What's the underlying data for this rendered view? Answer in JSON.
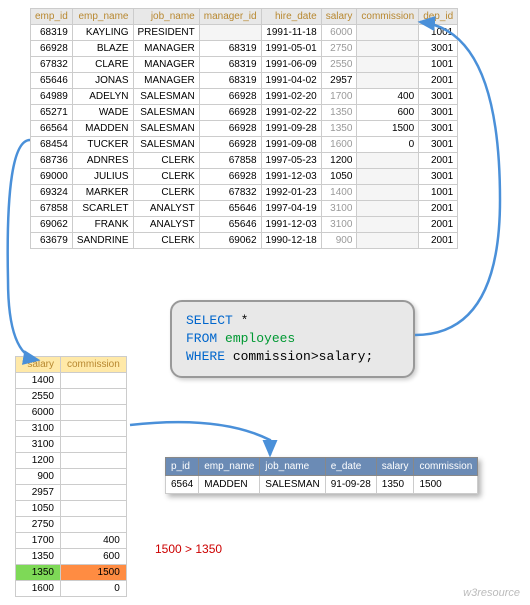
{
  "main_table": {
    "headers": [
      "emp_id",
      "emp_name",
      "job_name",
      "manager_id",
      "hire_date",
      "salary",
      "commission",
      "dep_id"
    ],
    "rows": [
      {
        "emp_id": "68319",
        "emp_name": "KAYLING",
        "job_name": "PRESIDENT",
        "manager_id": "",
        "hire_date": "1991-11-18",
        "salary": "6000",
        "commission": "",
        "dep_id": "1001"
      },
      {
        "emp_id": "66928",
        "emp_name": "BLAZE",
        "job_name": "MANAGER",
        "manager_id": "68319",
        "hire_date": "1991-05-01",
        "salary": "2750",
        "commission": "",
        "dep_id": "3001"
      },
      {
        "emp_id": "67832",
        "emp_name": "CLARE",
        "job_name": "MANAGER",
        "manager_id": "68319",
        "hire_date": "1991-06-09",
        "salary": "2550",
        "commission": "",
        "dep_id": "1001"
      },
      {
        "emp_id": "65646",
        "emp_name": "JONAS",
        "job_name": "MANAGER",
        "manager_id": "68319",
        "hire_date": "1991-04-02",
        "salary": "2957",
        "commission": "",
        "dep_id": "2001"
      },
      {
        "emp_id": "64989",
        "emp_name": "ADELYN",
        "job_name": "SALESMAN",
        "manager_id": "66928",
        "hire_date": "1991-02-20",
        "salary": "1700",
        "commission": "400",
        "dep_id": "3001"
      },
      {
        "emp_id": "65271",
        "emp_name": "WADE",
        "job_name": "SALESMAN",
        "manager_id": "66928",
        "hire_date": "1991-02-22",
        "salary": "1350",
        "commission": "600",
        "dep_id": "3001"
      },
      {
        "emp_id": "66564",
        "emp_name": "MADDEN",
        "job_name": "SALESMAN",
        "manager_id": "66928",
        "hire_date": "1991-09-28",
        "salary": "1350",
        "commission": "1500",
        "dep_id": "3001"
      },
      {
        "emp_id": "68454",
        "emp_name": "TUCKER",
        "job_name": "SALESMAN",
        "manager_id": "66928",
        "hire_date": "1991-09-08",
        "salary": "1600",
        "commission": "0",
        "dep_id": "3001"
      },
      {
        "emp_id": "68736",
        "emp_name": "ADNRES",
        "job_name": "CLERK",
        "manager_id": "67858",
        "hire_date": "1997-05-23",
        "salary": "1200",
        "commission": "",
        "dep_id": "2001"
      },
      {
        "emp_id": "69000",
        "emp_name": "JULIUS",
        "job_name": "CLERK",
        "manager_id": "66928",
        "hire_date": "1991-12-03",
        "salary": "1050",
        "commission": "",
        "dep_id": "3001"
      },
      {
        "emp_id": "69324",
        "emp_name": "MARKER",
        "job_name": "CLERK",
        "manager_id": "67832",
        "hire_date": "1992-01-23",
        "salary": "1400",
        "commission": "",
        "dep_id": "1001"
      },
      {
        "emp_id": "67858",
        "emp_name": "SCARLET",
        "job_name": "ANALYST",
        "manager_id": "65646",
        "hire_date": "1997-04-19",
        "salary": "3100",
        "commission": "",
        "dep_id": "2001"
      },
      {
        "emp_id": "69062",
        "emp_name": "FRANK",
        "job_name": "ANALYST",
        "manager_id": "65646",
        "hire_date": "1991-12-03",
        "salary": "3100",
        "commission": "",
        "dep_id": "2001"
      },
      {
        "emp_id": "63679",
        "emp_name": "SANDRINE",
        "job_name": "CLERK",
        "manager_id": "69062",
        "hire_date": "1990-12-18",
        "salary": "900",
        "commission": "",
        "dep_id": "2001"
      }
    ]
  },
  "sql": {
    "l1a": "SELECT ",
    "l1b": "*",
    "l2a": "FROM ",
    "l2b": "employees",
    "l3a": "WHERE ",
    "l3b": "commission",
    "l3c": ">",
    "l3d": "salary",
    "l3e": ";"
  },
  "sub_table": {
    "headers": [
      "salary",
      "commission"
    ],
    "rows": [
      {
        "salary": "1400",
        "commission": ""
      },
      {
        "salary": "2550",
        "commission": ""
      },
      {
        "salary": "6000",
        "commission": ""
      },
      {
        "salary": "3100",
        "commission": ""
      },
      {
        "salary": "3100",
        "commission": ""
      },
      {
        "salary": "1200",
        "commission": ""
      },
      {
        "salary": "900",
        "commission": ""
      },
      {
        "salary": "2957",
        "commission": ""
      },
      {
        "salary": "1050",
        "commission": ""
      },
      {
        "salary": "2750",
        "commission": ""
      },
      {
        "salary": "1700",
        "commission": "400"
      },
      {
        "salary": "1350",
        "commission": "600"
      },
      {
        "salary": "1350",
        "commission": "1500",
        "hl": true
      },
      {
        "salary": "1600",
        "commission": "0"
      }
    ]
  },
  "comparison_text": "1500 > 1350",
  "result_table": {
    "headers": [
      "p_id",
      "emp_name",
      "job_name",
      "e_date",
      "salary",
      "commission"
    ],
    "row": {
      "p_id": "6564",
      "emp_name": "MADDEN",
      "job_name": "SALESMAN",
      "e_date": "91-09-28",
      "salary": "1350",
      "commission": "1500"
    }
  },
  "watermark": "w3resource"
}
